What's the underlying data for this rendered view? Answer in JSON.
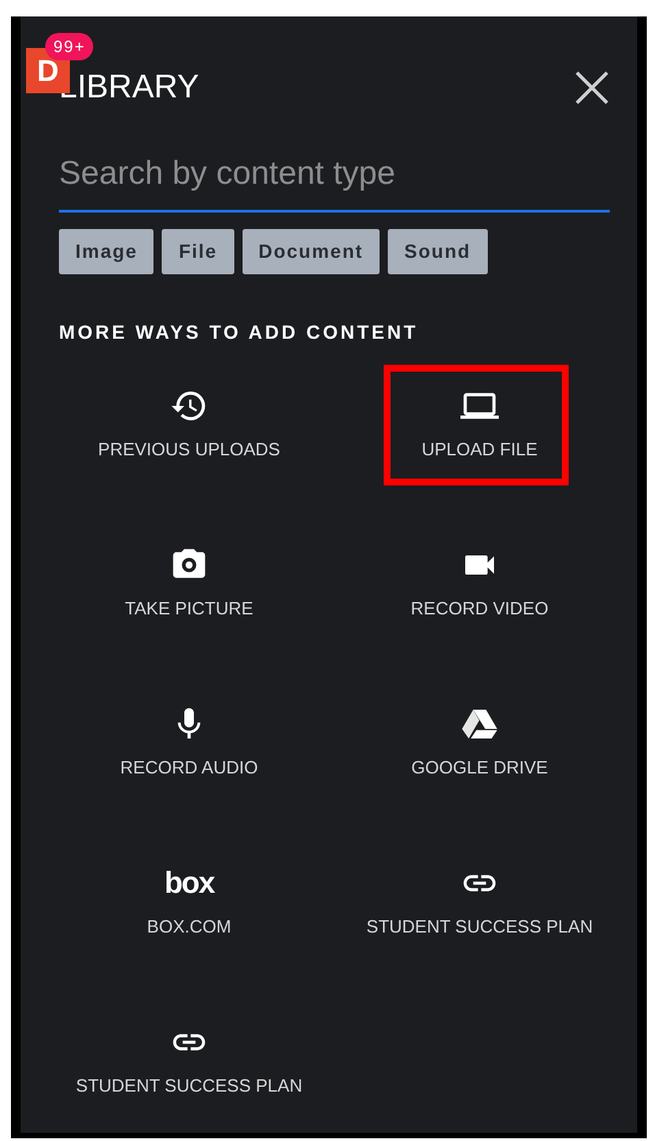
{
  "badge": {
    "letter": "D",
    "count": "99+"
  },
  "header": {
    "title": "LIBRARY"
  },
  "search": {
    "placeholder": "Search by content type"
  },
  "filters": [
    {
      "label": "Image"
    },
    {
      "label": "File"
    },
    {
      "label": "Document"
    },
    {
      "label": "Sound"
    }
  ],
  "section_title": "MORE WAYS TO ADD CONTENT",
  "options": [
    {
      "label": "PREVIOUS UPLOADS",
      "highlighted": false
    },
    {
      "label": "UPLOAD FILE",
      "highlighted": true
    },
    {
      "label": "TAKE PICTURE",
      "highlighted": false
    },
    {
      "label": "RECORD VIDEO",
      "highlighted": false
    },
    {
      "label": "RECORD AUDIO",
      "highlighted": false
    },
    {
      "label": "GOOGLE DRIVE",
      "highlighted": false
    },
    {
      "label": "BOX.COM",
      "logo_text": "box",
      "highlighted": false
    },
    {
      "label": "STUDENT SUCCESS PLAN",
      "highlighted": false
    },
    {
      "label": "STUDENT SUCCESS PLAN",
      "highlighted": false
    }
  ]
}
